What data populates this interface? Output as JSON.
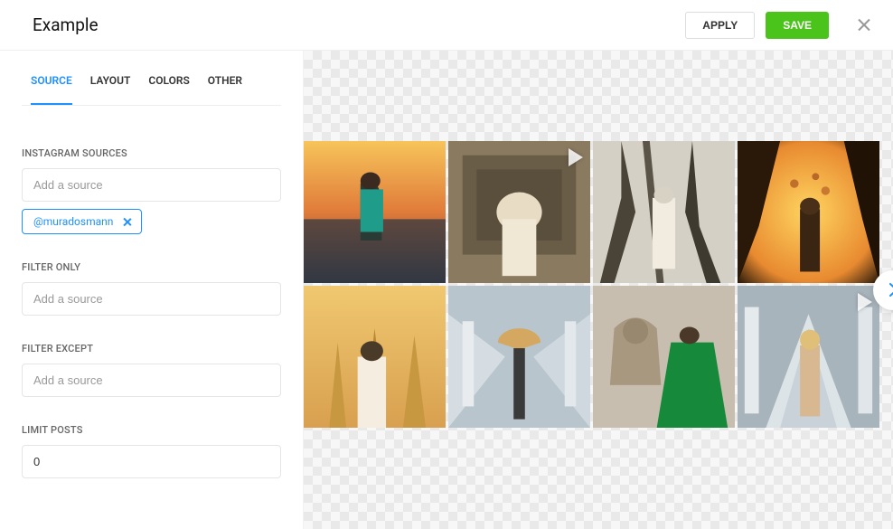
{
  "header": {
    "title": "Example",
    "apply": "APPLY",
    "save": "SAVE"
  },
  "tabs": [
    "SOURCE",
    "LAYOUT",
    "COLORS",
    "OTHER"
  ],
  "activeTab": 0,
  "sections": {
    "sources": {
      "label": "INSTAGRAM SOURCES",
      "placeholder": "Add a source",
      "chips": [
        "@muradosmann"
      ]
    },
    "filterOnly": {
      "label": "FILTER ONLY",
      "placeholder": "Add a source"
    },
    "filterExcept": {
      "label": "FILTER EXCEPT",
      "placeholder": "Add a source"
    },
    "limitPosts": {
      "label": "LIMIT POSTS",
      "value": "0"
    }
  },
  "preview": {
    "thumbs": [
      {
        "video": false
      },
      {
        "video": true
      },
      {
        "video": false
      },
      {
        "video": false
      },
      {
        "video": false
      },
      {
        "video": false
      },
      {
        "video": false
      },
      {
        "video": true
      }
    ]
  }
}
